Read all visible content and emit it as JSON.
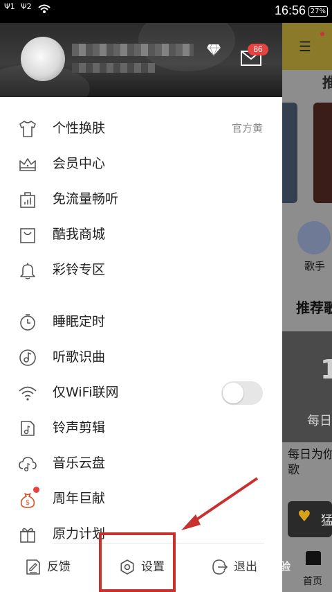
{
  "status_bar": {
    "sim1": "1",
    "sim2": "2",
    "time": "16:56",
    "battery": "27%"
  },
  "drawer": {
    "mail_badge": "86",
    "items": [
      {
        "label": "个性换肤",
        "value": "官方黄",
        "icon": "tshirt-icon"
      },
      {
        "label": "会员中心",
        "icon": "crown-icon"
      },
      {
        "label": "免流量畅听",
        "icon": "data-bag-icon"
      },
      {
        "label": "酷我商城",
        "icon": "shopping-bag-icon"
      },
      {
        "label": "彩铃专区",
        "icon": "bell-icon"
      },
      {
        "label": "睡眠定时",
        "icon": "timer-icon"
      },
      {
        "label": "听歌识曲",
        "icon": "music-disc-icon"
      },
      {
        "label": "仅WiFi联网",
        "icon": "wifi-icon",
        "toggle": false
      },
      {
        "label": "铃声剪辑",
        "icon": "ringtone-edit-icon"
      },
      {
        "label": "音乐云盘",
        "icon": "cloud-music-icon"
      },
      {
        "label": "周年巨献",
        "icon": "money-bag-icon"
      },
      {
        "label": "原力计划",
        "icon": "gift-icon"
      }
    ],
    "bottom": {
      "feedback": "反馈",
      "settings": "设置",
      "exit": "退出"
    }
  },
  "background_app": {
    "tab_fragment": "推",
    "singer_label": "歌手",
    "recommend_fragment": "推荐歌",
    "banner_num": "1",
    "banner_sub": "每日",
    "daily_text_line1": "每日为你",
    "daily_text_line2": "歌",
    "promo_text": "猛",
    "home_label": "首页"
  },
  "watermark": "经验",
  "colors": {
    "accent_red": "#c8322e",
    "badge_red": "#e64340"
  }
}
